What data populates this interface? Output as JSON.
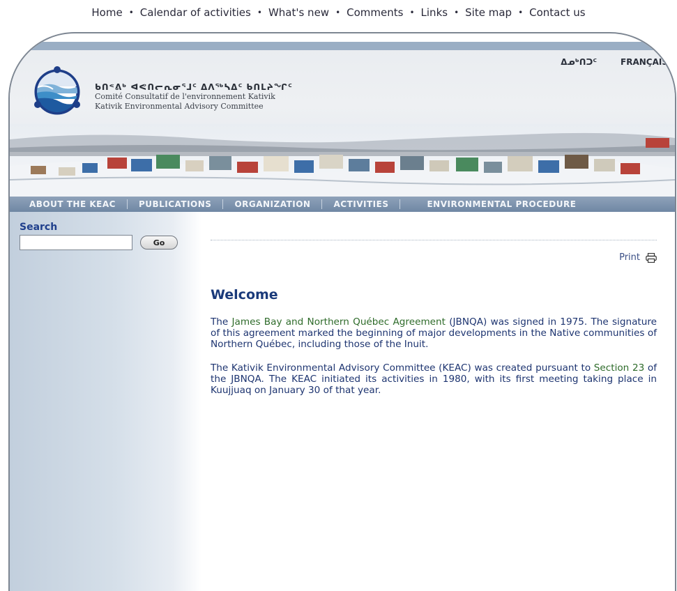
{
  "topnav": {
    "items": [
      "Home",
      "Calendar of activities",
      "What's new",
      "Comments",
      "Links",
      "Site map",
      "Contact us"
    ],
    "separator": "•"
  },
  "header": {
    "lang_inuktitut": "ᐃᓄᒃᑎᑐᑦ",
    "lang_french": "FRANÇAIS",
    "org_syllabics": "ᑲᑎᕝᕕᒃ ᐊᕙᑎᓕᕆᓂᕐᒧᑦ ᐃᐱᖅᓴᐃᑦ ᑲᑎᒪᔨᖏᑦ",
    "org_french": "Comité Consultatif de l'environnement Kativik",
    "org_english": "Kativik Environmental Advisory Committee",
    "logo_icon": "keac-logo-icon",
    "colors": {
      "band": "#9aaec4",
      "nav": "#7c92ae"
    }
  },
  "mainnav": {
    "items": [
      "ABOUT THE KEAC",
      "PUBLICATIONS",
      "ORGANIZATION",
      "ACTIVITIES",
      "ENVIRONMENTAL PROCEDURE"
    ]
  },
  "sidebar": {
    "search_label": "Search",
    "search_value": "",
    "go_label": "Go"
  },
  "content": {
    "print_label": "Print",
    "print_icon": "printer-icon",
    "title": "Welcome",
    "para1": {
      "before": "The ",
      "link": "James Bay and Northern Québec Agreement",
      "after": " (JBNQA) was signed in 1975. The signature of this agreement marked the beginning of major developments in the Native communities of Northern Québec, including those of the Inuit."
    },
    "para2": {
      "before": "The Kativik Environmental Advisory Committee (KEAC) was created pursuant to ",
      "link": "Section 23",
      "after": " of the JBNQA. The KEAC initiated its activities in 1980, with its first meeting taking place in Kuujjuaq on January 30 of that year."
    },
    "link_color": "#2e6b2a",
    "text_color": "#1d3470"
  }
}
